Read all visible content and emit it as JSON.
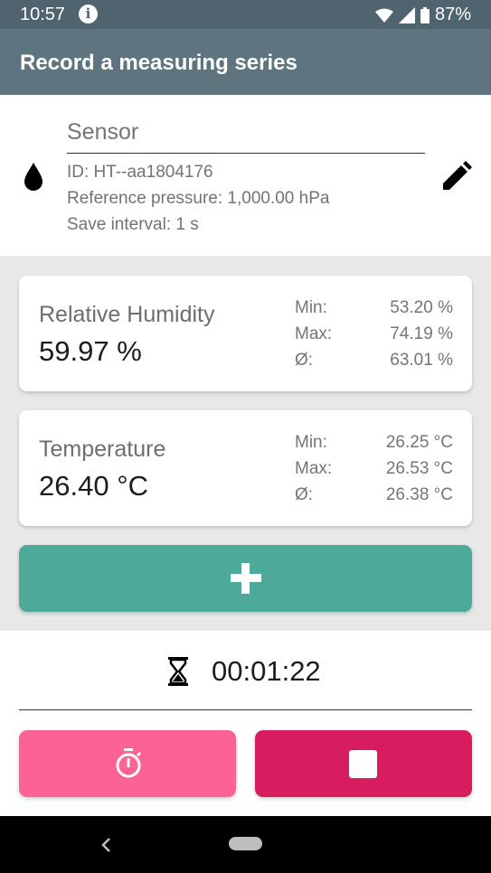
{
  "status_bar": {
    "time": "10:57",
    "battery": "87%"
  },
  "app_bar": {
    "title": "Record a measuring series"
  },
  "sensor": {
    "title": "Sensor",
    "id_line": "ID: HT--aa1804176",
    "pressure_line": "Reference pressure: 1,000.00 hPa",
    "interval_line": "Save interval: 1 s"
  },
  "humidity": {
    "label": "Relative Humidity",
    "value": "59.97 %",
    "min_label": "Min:",
    "min_value": "53.20 %",
    "max_label": "Max:",
    "max_value": "74.19 %",
    "avg_label": "Ø:",
    "avg_value": "63.01 %"
  },
  "temperature": {
    "label": "Temperature",
    "value": "26.40 °C",
    "min_label": "Min:",
    "min_value": "26.25 °C",
    "max_label": "Max:",
    "max_value": "26.53 °C",
    "avg_label": "Ø:",
    "avg_value": "26.38 °C"
  },
  "timer": {
    "elapsed": "00:01:22"
  },
  "icons": {
    "sensor": "water-drop-icon",
    "edit": "pencil-icon",
    "add": "plus-icon",
    "elapsed": "hourglass-icon",
    "stopwatch": "stopwatch-icon",
    "stop": "stop-icon"
  },
  "colors": {
    "app_bar": "#5e7580",
    "status_bar": "#4f646e",
    "add_button": "#4daa98",
    "stopwatch_button": "#fc6394",
    "stop_button": "#d81c60"
  }
}
